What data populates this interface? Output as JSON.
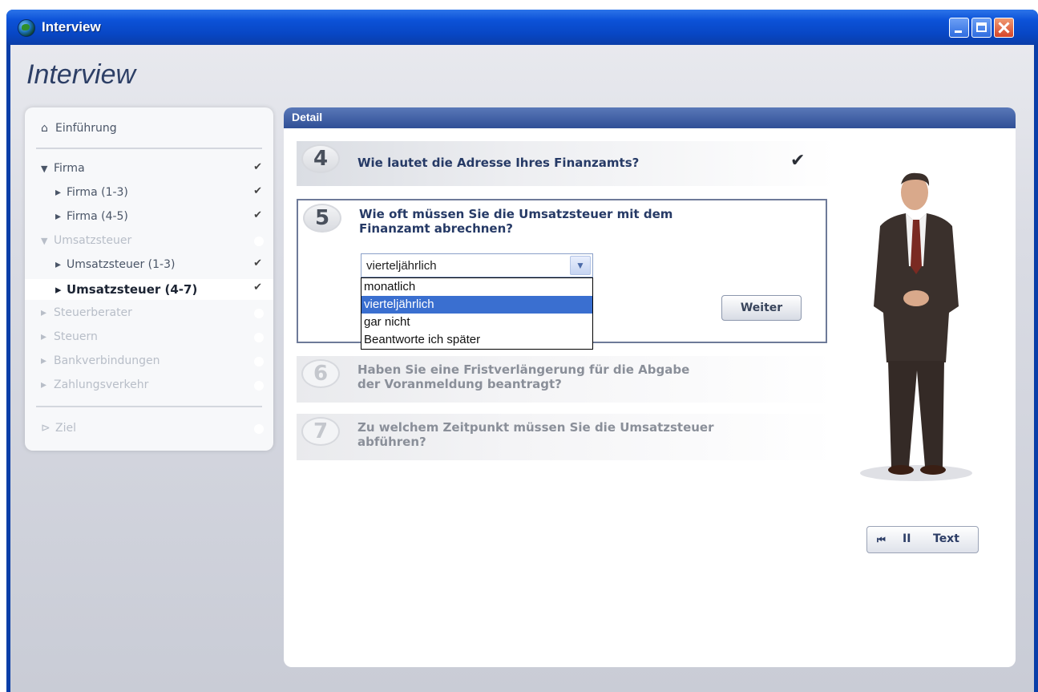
{
  "window": {
    "title": "Interview"
  },
  "app": {
    "heading": "Interview"
  },
  "sidebar": {
    "home": "Einführung",
    "items": [
      {
        "label": "Firma",
        "marker": "▼",
        "status": "✔"
      },
      {
        "label": "Firma (1-3)",
        "marker": "▸",
        "status": "✔"
      },
      {
        "label": "Firma (4-5)",
        "marker": "▸",
        "status": "✔"
      },
      {
        "label": "Umsatzsteuer",
        "marker": "▼",
        "status": ""
      },
      {
        "label": "Umsatzsteuer (1-3)",
        "marker": "▸",
        "status": "✔"
      },
      {
        "label": "Umsatzsteuer (4-7)",
        "marker": "▸",
        "status": "✔"
      },
      {
        "label": "Steuerberater",
        "marker": "▸",
        "status": ""
      },
      {
        "label": "Steuern",
        "marker": "▸",
        "status": ""
      },
      {
        "label": "Bankverbindungen",
        "marker": "▸",
        "status": ""
      },
      {
        "label": "Zahlungsverkehr",
        "marker": "▸",
        "status": ""
      }
    ],
    "goal": "Ziel"
  },
  "detail": {
    "header": "Detail",
    "questions": [
      {
        "number": "4",
        "text": "Wie lautet die Adresse Ihres Finanzamts?",
        "done": "✔"
      },
      {
        "number": "5",
        "text_line1": "Wie oft müssen Sie die Umsatzsteuer mit dem",
        "text_line2": "Finanzamt abrechnen?"
      },
      {
        "number": "6",
        "text_line1": "Haben Sie eine Fristverlängerung für die Abgabe",
        "text_line2": "der Voranmeldung beantragt?"
      },
      {
        "number": "7",
        "text_line1": "Zu welchem Zeitpunkt müssen Sie die Umsatzsteuer",
        "text_line2": "abführen?"
      }
    ],
    "select": {
      "value": "vierteljährlich",
      "options": [
        "monatlich",
        "vierteljährlich",
        "gar nicht",
        "Beantworte ich später"
      ]
    },
    "next_button": "Weiter"
  },
  "media": {
    "back_icon": "⏮",
    "pause_icon": "II",
    "text_label": "Text"
  }
}
